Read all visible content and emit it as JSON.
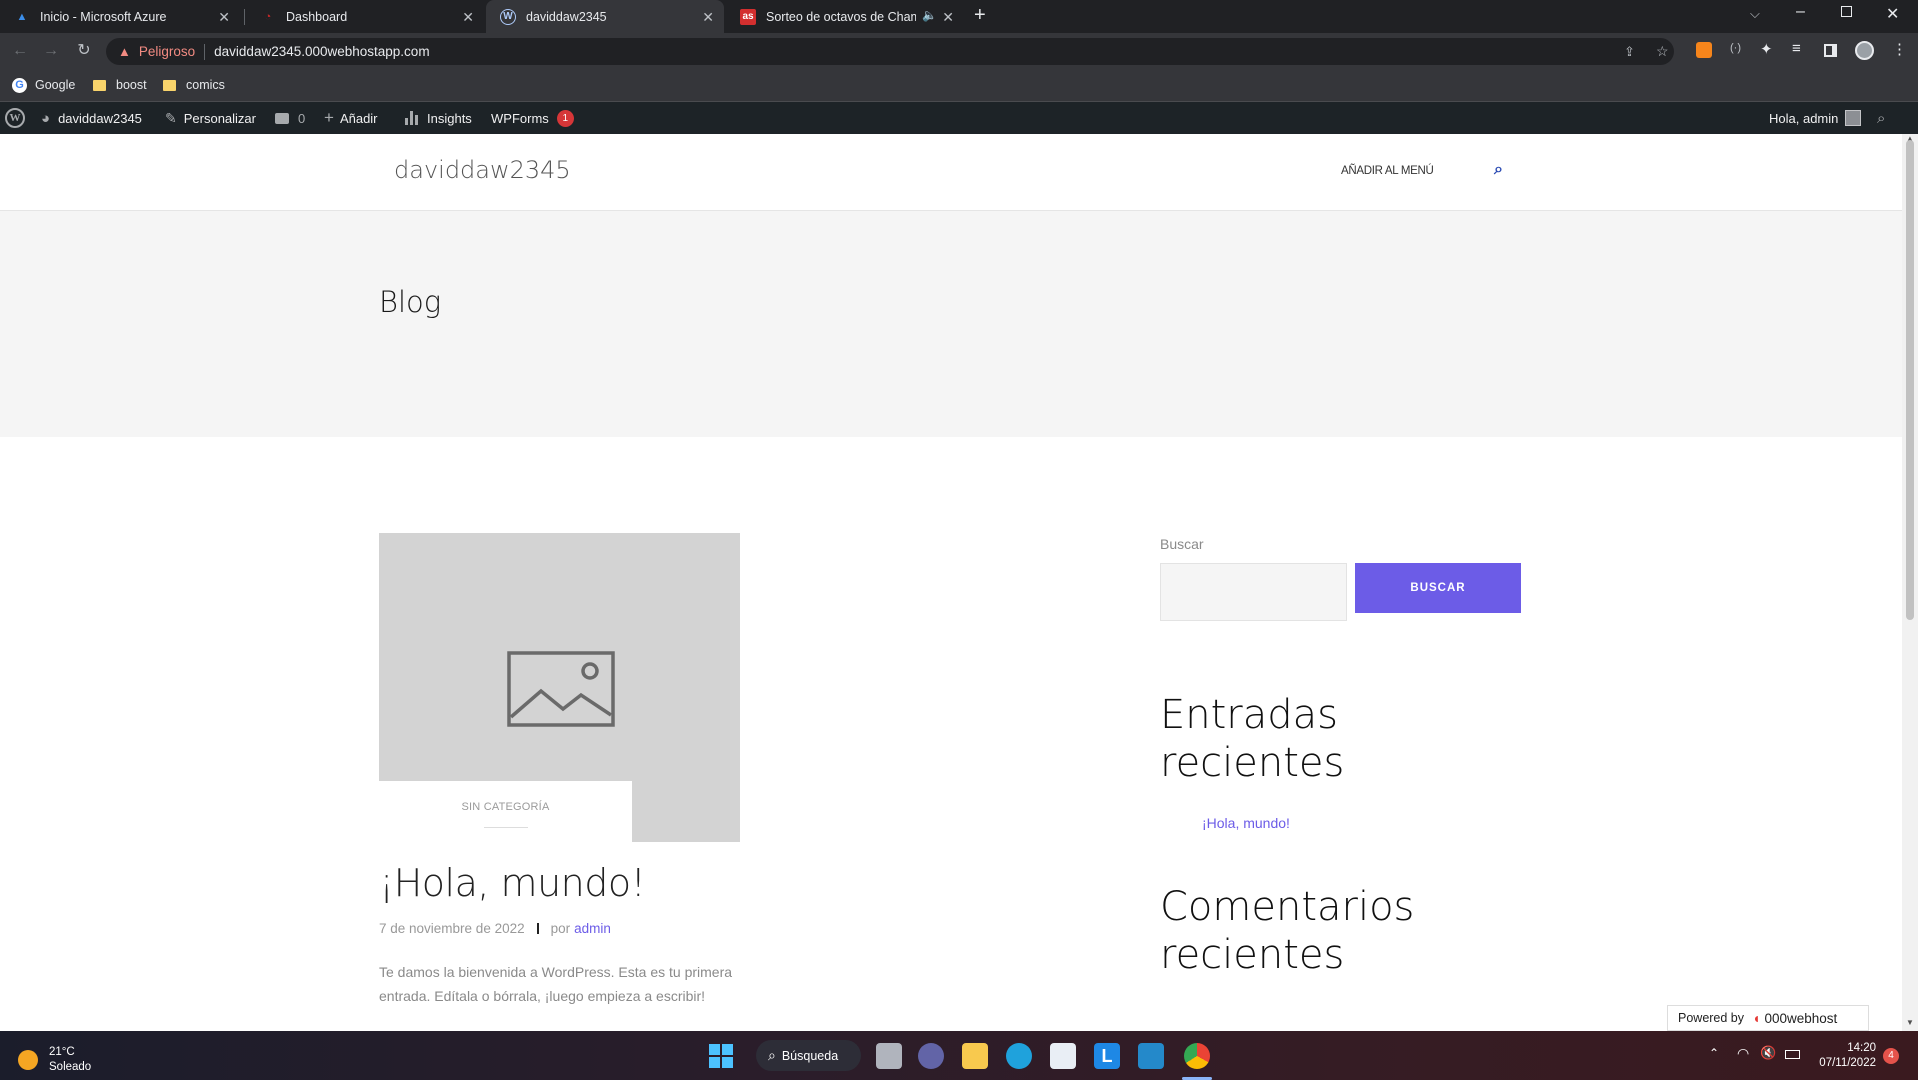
{
  "tabs": [
    {
      "title": "Inicio - Microsoft Azure",
      "icon": "azure-icon"
    },
    {
      "title": "Dashboard",
      "icon": "dashboard-icon"
    },
    {
      "title": "daviddaw2345",
      "icon": "wordpress-icon"
    },
    {
      "title": "Sorteo de octavos de Champ",
      "icon": "as-icon"
    }
  ],
  "as_favicon": "as",
  "omnibox": {
    "warning": "Peligroso",
    "url": "daviddaw2345.000webhostapp.com"
  },
  "bookmarks": [
    "Google",
    "boost",
    "comics"
  ],
  "wpbar": {
    "site": "daviddaw2345",
    "customize": "Personalizar",
    "comments": "0",
    "add": "Añadir",
    "insights": "Insights",
    "wpforms": "WPForms",
    "wpforms_badge": "1",
    "greeting": "Hola, admin"
  },
  "site": {
    "title": "daviddaw2345",
    "menu": "AÑADIR AL MENÚ",
    "page_title": "Blog"
  },
  "post": {
    "category": "SIN CATEGORÍA",
    "title": "¡Hola, mundo!",
    "date": "7 de noviembre de 2022",
    "by": "por",
    "author": "admin",
    "excerpt": "Te damos la bienvenida a WordPress. Esta es tu primera entrada. Edítala o bórrala, ¡luego empieza a escribir!"
  },
  "sidebar": {
    "search_label": "Buscar",
    "search_button": "BUSCAR",
    "recent_posts_title": "Entradas recientes",
    "recent_post": "¡Hola, mundo!",
    "recent_comments_title": "Comentarios recientes"
  },
  "powered": {
    "label": "Powered by",
    "brand": "000webhost"
  },
  "taskbar": {
    "temp": "21°C",
    "weather": "Soleado",
    "search": "Búsqueda",
    "time": "14:20",
    "date": "07/11/2022",
    "notif": "4"
  },
  "colors": {
    "accent": "#6c5ce7",
    "wpbar": "#1d2327",
    "chrome_dark": "#202124",
    "warning": "#f28b82"
  }
}
